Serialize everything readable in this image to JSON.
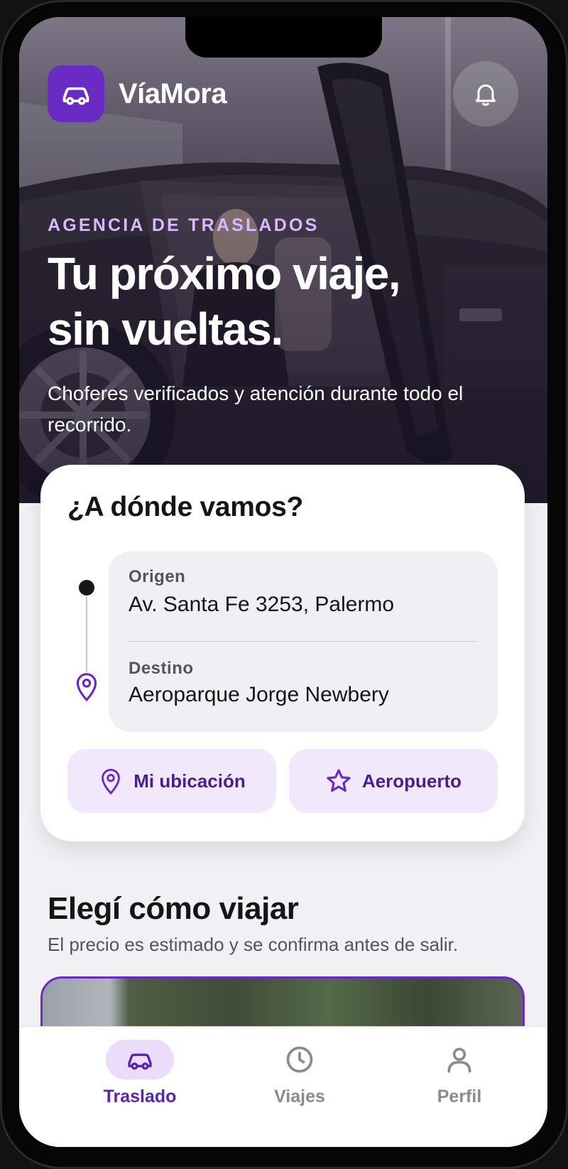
{
  "app": {
    "brand": "VíaMora"
  },
  "colors": {
    "accent": "#6a2bc4",
    "accent_soft": "#f1e8fb",
    "eyebrow": "#d9b8ff"
  },
  "header": {
    "logo_icon": "car-icon",
    "notification_icon": "bell-icon"
  },
  "hero": {
    "eyebrow": "AGENCIA DE TRASLADOS",
    "headline_line1": "Tu próximo viaje,",
    "headline_line2": "sin vueltas.",
    "subtitle": "Choferes verificados y atención durante todo el recorrido."
  },
  "booking": {
    "title": "¿A dónde vamos?",
    "origin": {
      "label": "Origen",
      "value": "Av. Santa Fe 3253, Palermo"
    },
    "destination": {
      "label": "Destino",
      "value": "Aeroparque Jorge Newbery"
    },
    "quick_options": [
      {
        "label": "Mi ubicación",
        "icon": "location-pin-icon"
      },
      {
        "label": "Aeropuerto",
        "icon": "star-icon"
      }
    ]
  },
  "travel_options": {
    "title": "Elegí cómo viajar",
    "subtitle": "El precio es estimado y se confirma antes de salir."
  },
  "bottom_nav": {
    "items": [
      {
        "label": "Traslado",
        "icon": "car-icon",
        "active": true
      },
      {
        "label": "Viajes",
        "icon": "clock-icon",
        "active": false
      },
      {
        "label": "Perfil",
        "icon": "person-icon",
        "active": false
      }
    ]
  }
}
